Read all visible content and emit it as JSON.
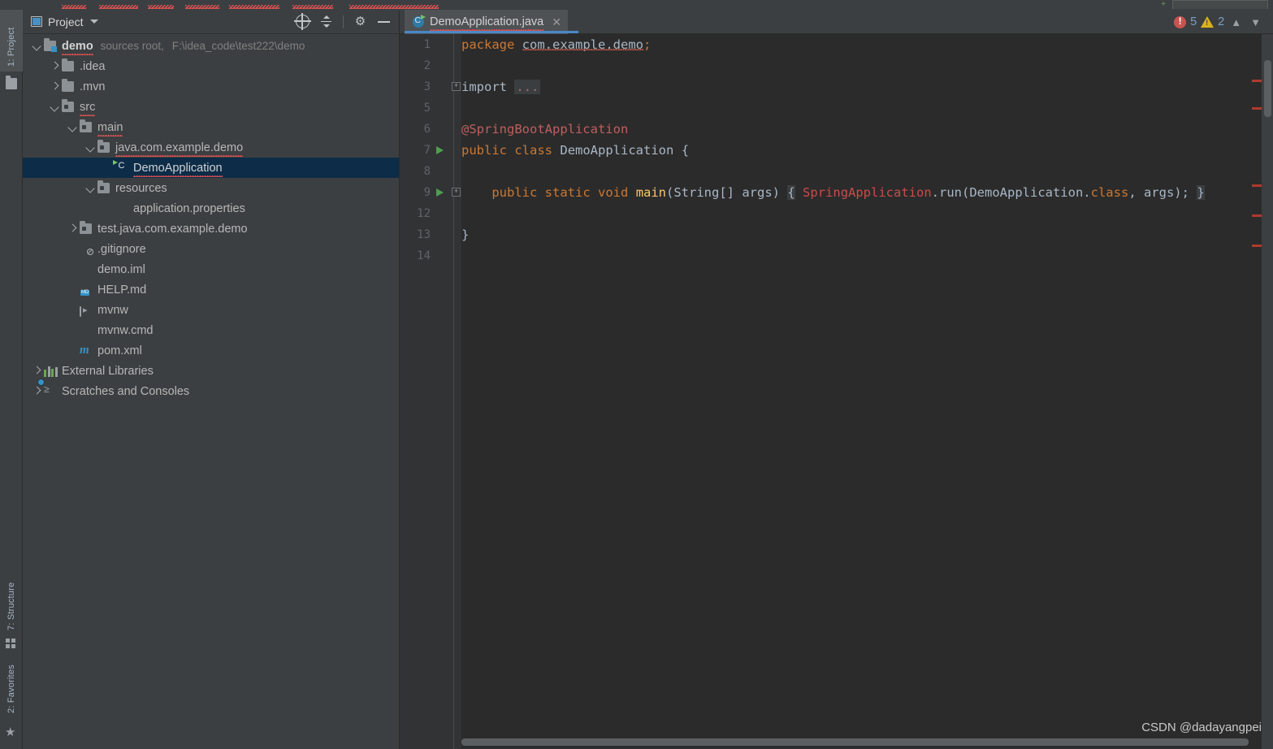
{
  "window": {
    "left_tool_tabs": [
      {
        "label": "1: Project",
        "icon": "folder-icon",
        "active": true
      },
      {
        "label": "7: Structure",
        "icon": "structure-icon",
        "active": false
      },
      {
        "label": "2: Favorites",
        "icon": "star-icon",
        "active": false
      }
    ]
  },
  "project_panel": {
    "title": "Project",
    "title_icon": "project-view-icon",
    "dropdown_icon": "chevron-down-icon",
    "tools": [
      {
        "name": "locate-icon",
        "label": "Select Opened File"
      },
      {
        "name": "collapse-all-icon",
        "label": "Collapse All"
      },
      {
        "name": "gear-icon",
        "label": "Settings"
      },
      {
        "name": "minimize-icon",
        "label": "Hide"
      }
    ],
    "tree": [
      {
        "depth": 0,
        "arrow": "down",
        "icon": "module-folder-icon",
        "label": "demo",
        "bold": true,
        "squiggle": true,
        "annotation": "sources root,",
        "annotation2": "F:\\idea_code\\test222\\demo",
        "selected": false
      },
      {
        "depth": 1,
        "arrow": "right",
        "icon": "folder-icon",
        "label": ".idea",
        "bold": false,
        "squiggle": false,
        "annotation": "",
        "annotation2": "",
        "selected": false
      },
      {
        "depth": 1,
        "arrow": "right",
        "icon": "folder-icon",
        "label": ".mvn",
        "bold": false,
        "squiggle": false,
        "annotation": "",
        "annotation2": "",
        "selected": false
      },
      {
        "depth": 1,
        "arrow": "down",
        "icon": "source-folder-icon",
        "label": "src",
        "bold": false,
        "squiggle": true,
        "annotation": "",
        "annotation2": "",
        "selected": false
      },
      {
        "depth": 2,
        "arrow": "down",
        "icon": "source-folder-icon",
        "label": "main",
        "bold": false,
        "squiggle": true,
        "annotation": "",
        "annotation2": "",
        "selected": false
      },
      {
        "depth": 3,
        "arrow": "down",
        "icon": "source-folder-icon",
        "label": "java.com.example.demo",
        "bold": false,
        "squiggle": true,
        "annotation": "",
        "annotation2": "",
        "selected": false
      },
      {
        "depth": 4,
        "arrow": "none",
        "icon": "spring-class-icon",
        "label": "DemoApplication",
        "bold": false,
        "squiggle": true,
        "annotation": "",
        "annotation2": "",
        "selected": true
      },
      {
        "depth": 3,
        "arrow": "down",
        "icon": "source-folder-icon",
        "label": "resources",
        "bold": false,
        "squiggle": false,
        "annotation": "",
        "annotation2": "",
        "selected": false
      },
      {
        "depth": 4,
        "arrow": "none",
        "icon": "properties-file-icon",
        "label": "application.properties",
        "bold": false,
        "squiggle": false,
        "annotation": "",
        "annotation2": "",
        "selected": false
      },
      {
        "depth": 2,
        "arrow": "right",
        "icon": "source-folder-icon",
        "label": "test.java.com.example.demo",
        "bold": false,
        "squiggle": false,
        "annotation": "",
        "annotation2": "",
        "selected": false
      },
      {
        "depth": 2,
        "arrow": "none",
        "icon": "gitignore-file-icon",
        "label": ".gitignore",
        "bold": false,
        "squiggle": false,
        "annotation": "",
        "annotation2": "",
        "selected": false
      },
      {
        "depth": 2,
        "arrow": "none",
        "icon": "iml-file-icon",
        "label": "demo.iml",
        "bold": false,
        "squiggle": false,
        "annotation": "",
        "annotation2": "",
        "selected": false
      },
      {
        "depth": 2,
        "arrow": "none",
        "icon": "markdown-file-icon",
        "label": "HELP.md",
        "bold": false,
        "squiggle": false,
        "annotation": "",
        "annotation2": "",
        "selected": false
      },
      {
        "depth": 2,
        "arrow": "none",
        "icon": "shell-script-icon",
        "label": "mvnw",
        "bold": false,
        "squiggle": false,
        "annotation": "",
        "annotation2": "",
        "selected": false
      },
      {
        "depth": 2,
        "arrow": "none",
        "icon": "cmd-file-icon",
        "label": "mvnw.cmd",
        "bold": false,
        "squiggle": false,
        "annotation": "",
        "annotation2": "",
        "selected": false
      },
      {
        "depth": 2,
        "arrow": "none",
        "icon": "maven-pom-icon",
        "label": "pom.xml",
        "bold": false,
        "squiggle": false,
        "annotation": "",
        "annotation2": "",
        "selected": false
      },
      {
        "depth": 0,
        "arrow": "right",
        "icon": "libraries-icon",
        "label": "External Libraries",
        "bold": false,
        "squiggle": false,
        "annotation": "",
        "annotation2": "",
        "selected": false
      },
      {
        "depth": 0,
        "arrow": "right",
        "icon": "scratches-icon",
        "label": "Scratches and Consoles",
        "bold": false,
        "squiggle": false,
        "annotation": "",
        "annotation2": "",
        "selected": false
      }
    ]
  },
  "editor": {
    "tab": {
      "label": "DemoApplication.java",
      "icon": "spring-class-icon",
      "close_icon": "close-icon"
    },
    "inspections": {
      "error_icon": "error-icon",
      "error_count": "5",
      "warning_icon": "warning-icon",
      "warning_count": "2",
      "prev_icon": "chevron-up-icon",
      "next_icon": "chevron-down-icon"
    },
    "line_numbers": [
      "1",
      "2",
      "3",
      "5",
      "6",
      "7",
      "8",
      "9",
      "12",
      "13",
      "14"
    ],
    "code_lines": [
      {
        "num": "1",
        "text": "package com.example.demo;"
      },
      {
        "num": "2",
        "text": ""
      },
      {
        "num": "3",
        "text": "import ..."
      },
      {
        "num": "5",
        "text": ""
      },
      {
        "num": "6",
        "text": "@SpringBootApplication"
      },
      {
        "num": "7",
        "text": "public class DemoApplication {"
      },
      {
        "num": "8",
        "text": ""
      },
      {
        "num": "9",
        "text": "    public static void main(String[] args) { SpringApplication.run(DemoApplication.class, args); }"
      },
      {
        "num": "12",
        "text": ""
      },
      {
        "num": "13",
        "text": "}"
      },
      {
        "num": "14",
        "text": ""
      }
    ],
    "tokens": {
      "package_kw": "package",
      "package_name": "com.example.demo",
      "semicolon": ";",
      "import_kw": "import",
      "import_folded": "...",
      "annotation": "@SpringBootApplication",
      "public_kw": "public",
      "class_kw": "class",
      "class_name": "DemoApplication",
      "open_brace": "{",
      "static_kw": "static",
      "void_kw": "void",
      "main_name": "main",
      "args_sig": "(String[] args)",
      "spring_app": "SpringApplication",
      "run_call": ".run(DemoApplication.",
      "class_kw2": "class",
      "args_arg": ", args);",
      "close_brace": "}"
    },
    "watermark": "CSDN @dadayangpei"
  },
  "colors": {
    "background": "#3c3f41",
    "editor_bg": "#2b2b2b",
    "gutter_bg": "#313335",
    "selection": "#0d2c47",
    "accent_blue": "#4a88c7",
    "keyword_orange": "#cc7832",
    "annotation_red": "#bf5f5f",
    "method_yellow": "#ffc66d",
    "text_grey": "#a9b7c6",
    "error_red": "#c75450",
    "warning_yellow": "#d9b21b",
    "run_green": "#4f9e4f"
  }
}
